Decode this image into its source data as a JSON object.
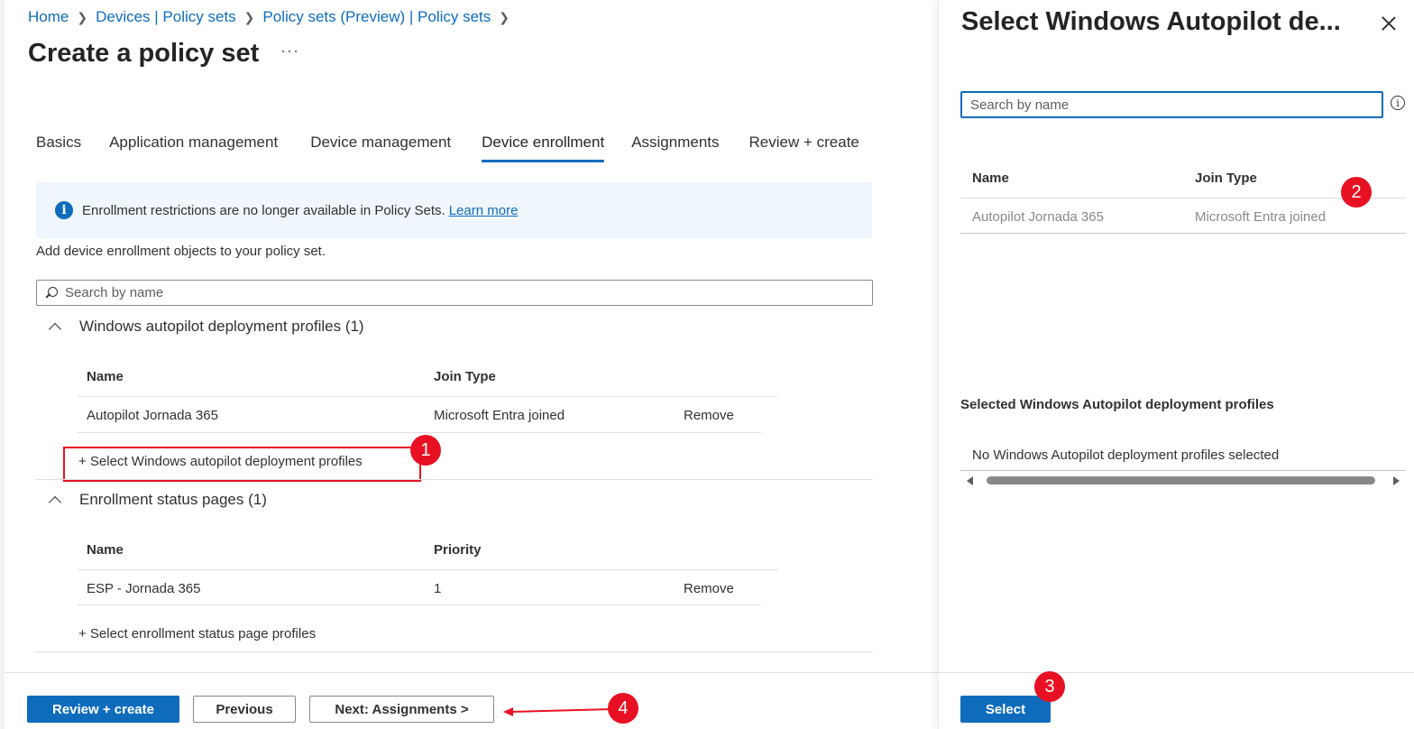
{
  "breadcrumb": [
    {
      "label": "Home"
    },
    {
      "label": "Devices | Policy sets"
    },
    {
      "label": "Policy sets (Preview) | Policy sets"
    }
  ],
  "page": {
    "title": "Create a policy set",
    "more": "···"
  },
  "tabs": [
    {
      "label": "Basics",
      "active": false
    },
    {
      "label": "Application management",
      "active": false
    },
    {
      "label": "Device management",
      "active": false
    },
    {
      "label": "Device enrollment",
      "active": true
    },
    {
      "label": "Assignments",
      "active": false
    },
    {
      "label": "Review + create",
      "active": false
    }
  ],
  "info_banner": {
    "text": "Enrollment restrictions are no longer available in Policy Sets.",
    "link": "Learn more",
    "icon": "info-icon"
  },
  "intro": "Add device enrollment objects to your policy set.",
  "main_search": {
    "placeholder": "Search by name",
    "icon": "search-icon"
  },
  "autopilot_section": {
    "title": "Windows autopilot deployment profiles (1)",
    "columns": [
      "Name",
      "Join Type"
    ],
    "rows": [
      {
        "name": "Autopilot Jornada 365",
        "join_type": "Microsoft Entra joined",
        "action": "Remove"
      }
    ],
    "add_link": "+ Select Windows autopilot deployment profiles"
  },
  "esp_section": {
    "title": "Enrollment status pages (1)",
    "columns": [
      "Name",
      "Priority"
    ],
    "rows": [
      {
        "name": "ESP - Jornada 365",
        "priority": "1",
        "action": "Remove"
      }
    ],
    "add_link": "+ Select enrollment status page profiles"
  },
  "footer": {
    "review_create": "Review + create",
    "previous": "Previous",
    "next": "Next: Assignments >"
  },
  "panel": {
    "title": "Select Windows Autopilot de...",
    "search_placeholder": "Search by name",
    "columns": [
      "Name",
      "Join Type"
    ],
    "rows": [
      {
        "name": "Autopilot Jornada 365",
        "join_type": "Microsoft Entra joined"
      }
    ],
    "selected_heading": "Selected Windows Autopilot deployment profiles",
    "selected_empty": "No Windows Autopilot deployment profiles selected",
    "select_button": "Select"
  },
  "annotations": [
    "1",
    "2",
    "3",
    "4"
  ],
  "colors": {
    "accent": "#0f6cbd",
    "annotation": "#e81123",
    "banner": "#eff6fc"
  }
}
